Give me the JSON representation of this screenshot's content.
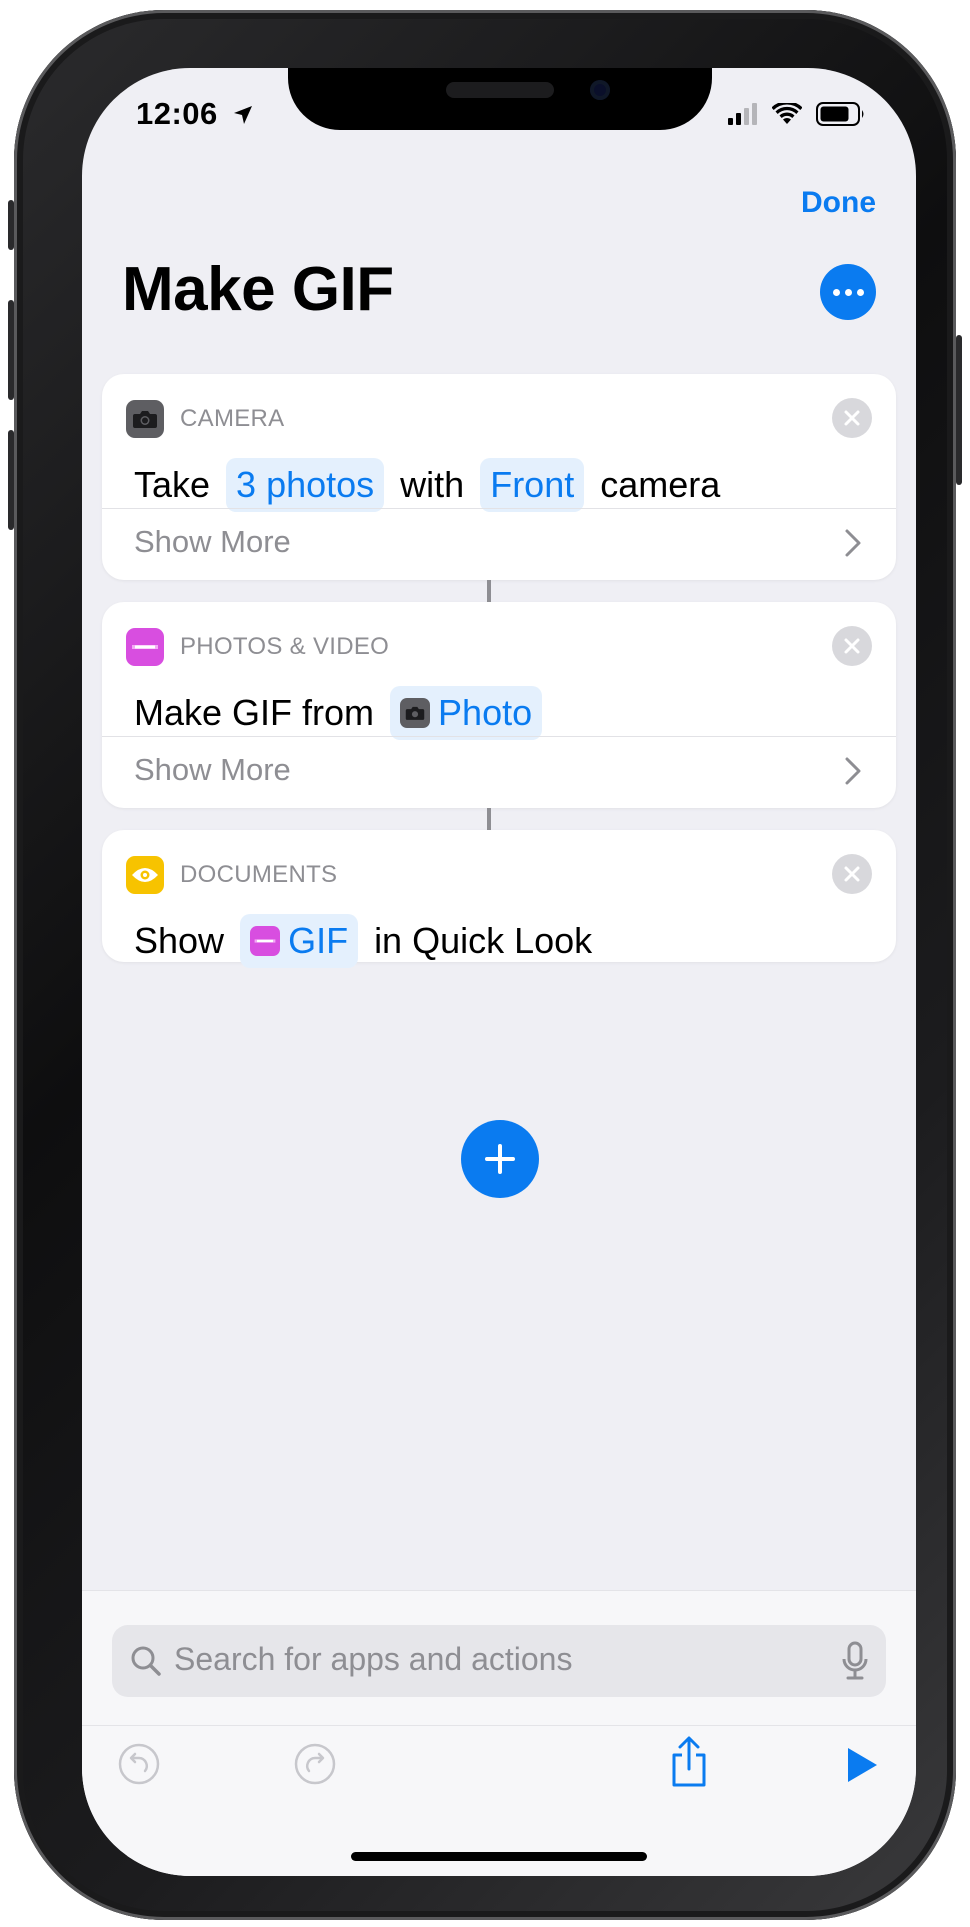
{
  "status_bar": {
    "time": "12:06"
  },
  "header": {
    "done_label": "Done",
    "title": "Make GIF"
  },
  "actions": [
    {
      "category": "CAMERA",
      "icon": "camera-icon",
      "words": [
        "Take",
        "3 photos",
        "with",
        "Front",
        "camera"
      ],
      "show_more": "Show More"
    },
    {
      "category": "PHOTOS & VIDEO",
      "icon": "photos-video-icon",
      "words": [
        "Make GIF from",
        "Photo"
      ],
      "show_more": "Show More"
    },
    {
      "category": "DOCUMENTS",
      "icon": "eye-icon",
      "words": [
        "Show",
        "GIF",
        "in Quick Look"
      ]
    }
  ],
  "search": {
    "placeholder": "Search for apps and actions"
  },
  "colors": {
    "accent": "#0a7bf0",
    "camera_icon_bg": "#5e5e62",
    "photos_icon_bg": "#d84ee0",
    "documents_icon_bg": "#f7c300"
  }
}
